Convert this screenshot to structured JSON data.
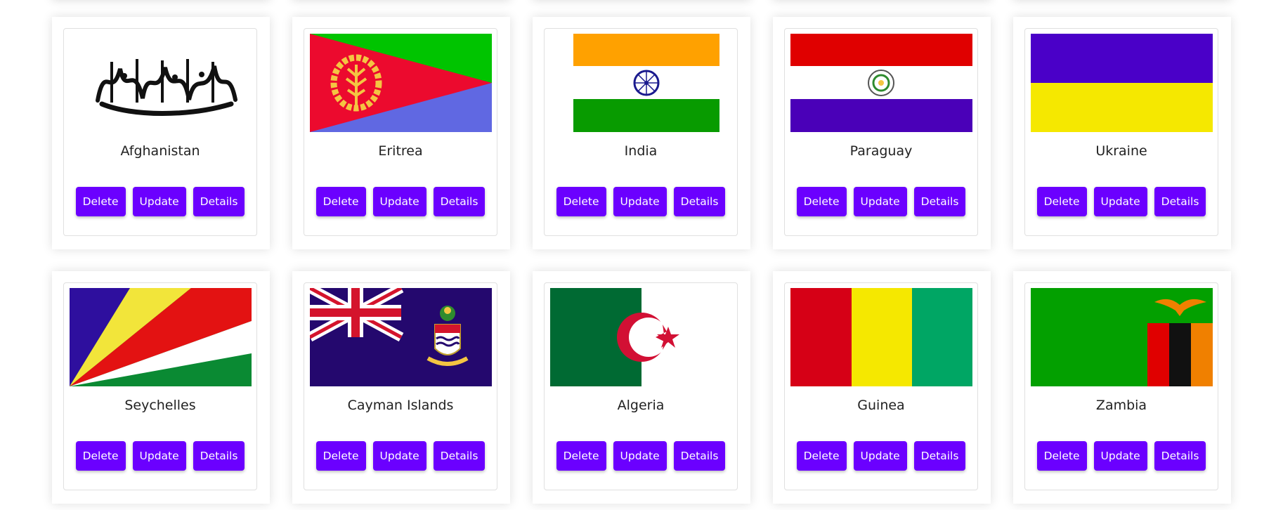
{
  "buttons": {
    "delete": "Delete",
    "update": "Update",
    "details": "Details"
  },
  "countries": [
    {
      "name": "Afghanistan",
      "flag_icon": "afghanistan-flag-icon"
    },
    {
      "name": "Eritrea",
      "flag_icon": "eritrea-flag-icon"
    },
    {
      "name": "India",
      "flag_icon": "india-flag-icon"
    },
    {
      "name": "Paraguay",
      "flag_icon": "paraguay-flag-icon"
    },
    {
      "name": "Ukraine",
      "flag_icon": "ukraine-flag-icon"
    },
    {
      "name": "Seychelles",
      "flag_icon": "seychelles-flag-icon"
    },
    {
      "name": "Cayman Islands",
      "flag_icon": "cayman-islands-flag-icon"
    },
    {
      "name": "Algeria",
      "flag_icon": "algeria-flag-icon"
    },
    {
      "name": "Guinea",
      "flag_icon": "guinea-flag-icon"
    },
    {
      "name": "Zambia",
      "flag_icon": "zambia-flag-icon"
    }
  ],
  "colors": {
    "button": "#6b00ff",
    "button_text": "#ffffff",
    "card_background": "#ffffff"
  }
}
